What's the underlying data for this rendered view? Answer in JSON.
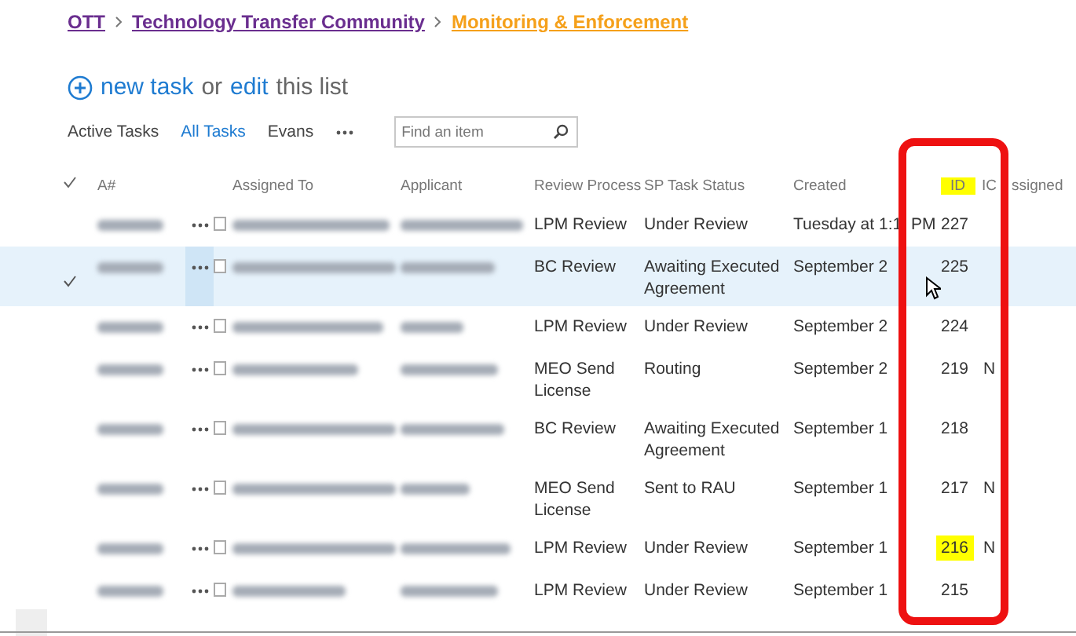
{
  "breadcrumb": [
    {
      "label": "OTT",
      "current": false
    },
    {
      "label": "Technology Transfer Community",
      "current": false
    },
    {
      "label": "Monitoring & Enforcement",
      "current": true
    }
  ],
  "command": {
    "new_label": "new task",
    "or": "or",
    "edit_label": "edit",
    "tail": "this list"
  },
  "views": [
    {
      "label": "Active Tasks",
      "selected": false
    },
    {
      "label": "All Tasks",
      "selected": true
    },
    {
      "label": "Evans",
      "selected": false
    }
  ],
  "search": {
    "placeholder": "Find an item"
  },
  "columns": [
    {
      "label": "A#",
      "highlighted": false
    },
    {
      "label": "Assigned To",
      "highlighted": false
    },
    {
      "label": "Applicant",
      "highlighted": false
    },
    {
      "label": "Review Process",
      "highlighted": false
    },
    {
      "label": "SP Task Status",
      "highlighted": false
    },
    {
      "label": "Created",
      "highlighted": false
    },
    {
      "label": "ID",
      "highlighted": true
    },
    {
      "label": "IC",
      "highlighted": false
    },
    {
      "label": "ssigned",
      "highlighted": false
    }
  ],
  "rows": [
    {
      "selected": false,
      "review": "LPM Review",
      "status": "Under Review",
      "created": "Tuesday at 1:1",
      "created_tail": "PM",
      "id": "227",
      "id_highlighted": false,
      "ic": ""
    },
    {
      "selected": true,
      "review": "BC Review",
      "status": "Awaiting Executed Agreement",
      "created": "September 2",
      "id": "225",
      "id_highlighted": false,
      "ic": ""
    },
    {
      "selected": false,
      "review": "LPM Review",
      "status": "Under Review",
      "created": "September 2",
      "id": "224",
      "id_highlighted": false,
      "ic": ""
    },
    {
      "selected": false,
      "review": "MEO Send License",
      "status": "Routing",
      "created": "September 2",
      "id": "219",
      "id_highlighted": false,
      "ic": "N"
    },
    {
      "selected": false,
      "review": "BC Review",
      "status": "Awaiting Executed Agreement",
      "created": "September 1",
      "id": "218",
      "id_highlighted": false,
      "ic": ""
    },
    {
      "selected": false,
      "review": "MEO Send License",
      "status": "Sent to RAU",
      "created": "September 1",
      "id": "217",
      "id_highlighted": false,
      "ic": "N"
    },
    {
      "selected": false,
      "review": "LPM Review",
      "status": "Under Review",
      "created": "September 1",
      "id": "216",
      "id_highlighted": true,
      "ic": "N"
    },
    {
      "selected": false,
      "review": "LPM Review",
      "status": "Under Review",
      "created": "September 1",
      "id": "215",
      "id_highlighted": false,
      "ic": ""
    }
  ]
}
